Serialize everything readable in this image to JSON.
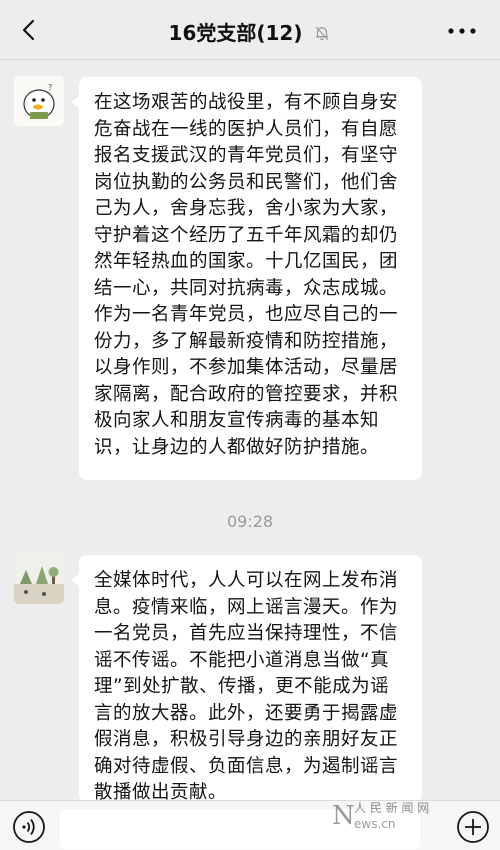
{
  "header": {
    "title": "16党支部(12)",
    "back_icon": "chevron-left-icon",
    "mute_icon": "bell-muted-icon",
    "more_icon": "more-dots-icon"
  },
  "messages": [
    {
      "avatar": "cartoon-duck-avatar",
      "text": "在这场艰苦的战役里，有不顾自身安危奋战在一线的医护人员们，有自愿报名支援武汉的青年党员们，有坚守岗位执勤的公务员和民警们，他们舍己为人，舍身忘我，舍小家为大家，守护着这个经历了五千年风霜的却仍然年轻热血的国家。十几亿国民，团结一心，共同对抗病毒，众志成城。作为一名青年党员，也应尽自己的一份力，多了解最新疫情和防控措施，以身作则，不参加集体活动，尽量居家隔离，配合政府的管控要求，并积极向家人和朋友宣传病毒的基本知识，让身边的人都做好防护措施。"
    },
    {
      "avatar": "landscape-photo-avatar",
      "text": "全媒体时代，人人可以在网上发布消息。疫情来临，网上谣言漫天。作为一名党员，首先应当保持理性，不信谣不传谣。不能把小道消息当做“真理”到处扩散、传播，更不能成为谣言的放大器。此外，还要勇于揭露虚假消息，积极引导身边的亲朋好友正确对待虚假、负面信息，为遏制谣言散播做出贡献。"
    }
  ],
  "timestamp": "09:28",
  "input_bar": {
    "voice_icon": "voice-icon",
    "plus_icon": "plus-circle-icon"
  },
  "watermark": {
    "text": "人民网 news.cn"
  },
  "colors": {
    "background": "#ededed",
    "bubble": "#ffffff",
    "time": "#9a9a9a"
  }
}
